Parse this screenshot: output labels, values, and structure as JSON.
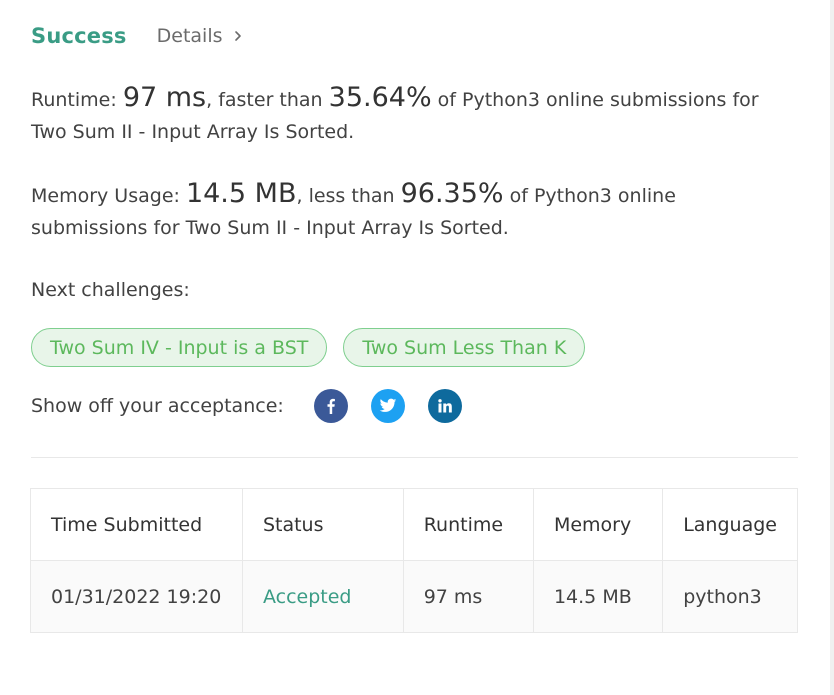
{
  "header": {
    "status": "Success",
    "details_link": "Details"
  },
  "runtime": {
    "label": "Runtime: ",
    "value": "97 ms",
    "text1": ", faster than ",
    "percent": "35.64%",
    "text2": " of Python3 online submissions for Two Sum II - Input Array Is Sorted."
  },
  "memory": {
    "label": "Memory Usage: ",
    "value": "14.5 MB",
    "text1": ", less than ",
    "percent": "96.35%",
    "text2": " of Python3 online submissions for Two Sum II - Input Array Is Sorted."
  },
  "next_challenges": {
    "label": "Next challenges:",
    "items": [
      "Two Sum IV - Input is a BST",
      "Two Sum Less Than K"
    ]
  },
  "share": {
    "label": "Show off your acceptance:",
    "icons": [
      "facebook-icon",
      "twitter-icon",
      "linkedin-icon"
    ],
    "colors": {
      "facebook": "#3b5998",
      "twitter": "#1da1f2",
      "linkedin": "#0e6a9d"
    }
  },
  "submissions": {
    "columns": [
      "Time Submitted",
      "Status",
      "Runtime",
      "Memory",
      "Language"
    ],
    "rows": [
      {
        "time": "01/31/2022 19:20",
        "status": "Accepted",
        "runtime": "97 ms",
        "memory": "14.5 MB",
        "language": "python3"
      }
    ]
  },
  "colors": {
    "accent": "#3a9c85",
    "chip_text": "#5cb85c",
    "chip_bg": "#e8f5e9"
  }
}
